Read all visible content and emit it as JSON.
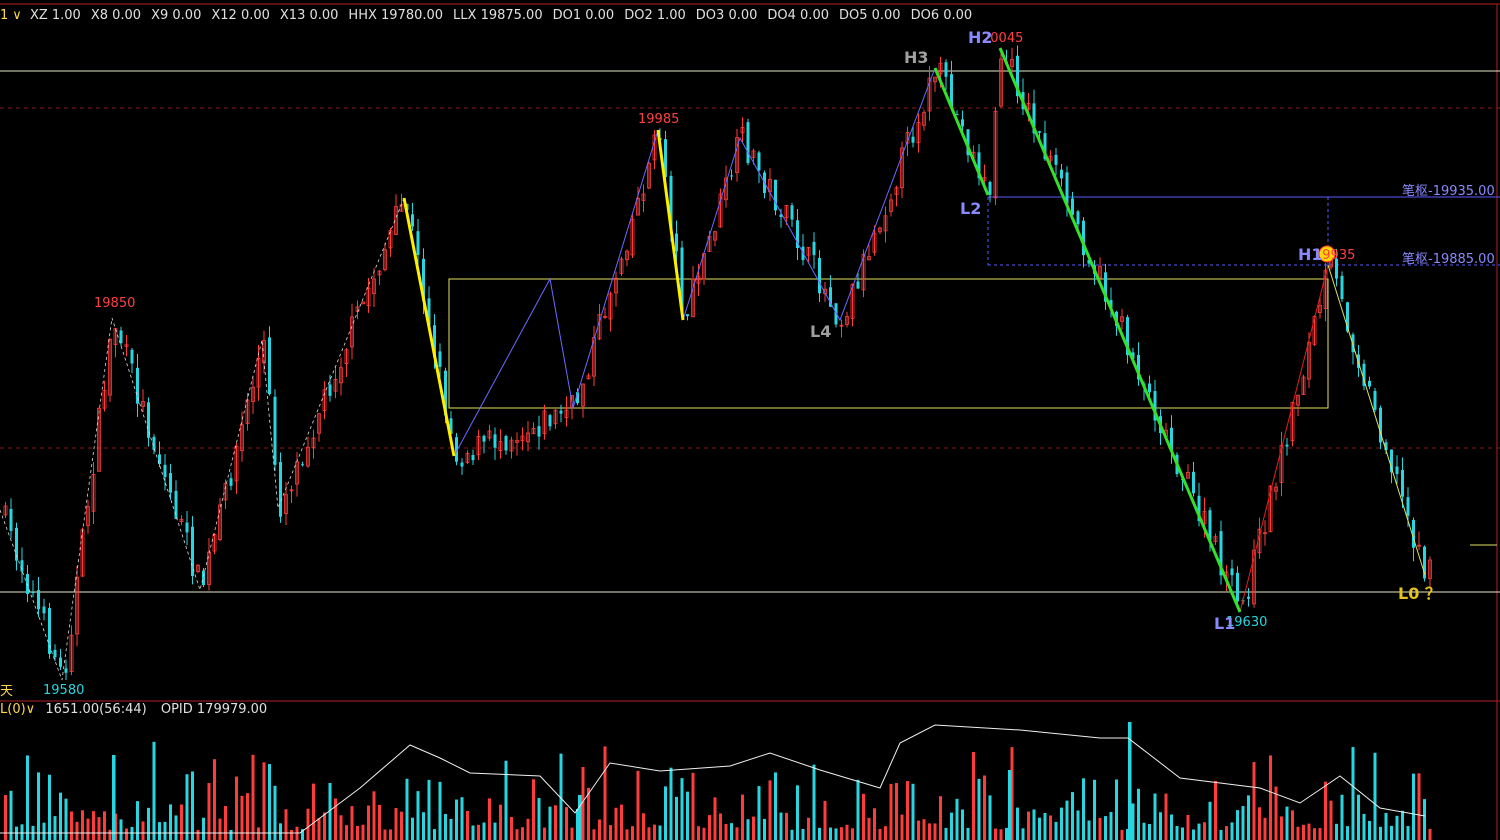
{
  "header": {
    "indicator_name": "1",
    "params": [
      {
        "k": "XZ",
        "v": "1.00"
      },
      {
        "k": "X8",
        "v": "0.00"
      },
      {
        "k": "X9",
        "v": "0.00"
      },
      {
        "k": "X12",
        "v": "0.00"
      },
      {
        "k": "X13",
        "v": "0.00"
      },
      {
        "k": "HHX",
        "v": "19780.00"
      },
      {
        "k": "LLX",
        "v": "19875.00"
      },
      {
        "k": "DO1",
        "v": "0.00"
      },
      {
        "k": "DO2",
        "v": "1.00"
      },
      {
        "k": "DO3",
        "v": "0.00"
      },
      {
        "k": "DO4",
        "v": "0.00"
      },
      {
        "k": "DO5",
        "v": "0.00"
      },
      {
        "k": "DO6",
        "v": "0.00"
      }
    ]
  },
  "volume_header": {
    "indicator_name": "L(0)",
    "vol": "1651.00(56:44)",
    "opid_label": "OPID",
    "opid_value": "179979.00"
  },
  "period_label": "天",
  "price_labels": {
    "p19580": "19580",
    "p19850": "19850",
    "p19985": "19985",
    "p20045": "20045",
    "p19935": "19935",
    "p19630": "19630"
  },
  "pivot_labels": {
    "h3": "H3",
    "h2": "H2",
    "l2": "L2",
    "l4": "L4",
    "h1": "H1",
    "l1": "L1",
    "l0": "L0 ？"
  },
  "right_labels": {
    "pen1": "笔枢-19935.00",
    "pen2": "笔枢-19885.00"
  },
  "colors": {
    "up": "#ff3c3c",
    "down": "#27d6e0",
    "green": "#33e02b",
    "yellow": "#ffee00",
    "label_blue": "#8a8aff",
    "label_gray": "#a0a0a0",
    "label_red": "#ff4040",
    "label_cyan": "#27d6e0",
    "label_gold": "#e6c21c"
  }
}
